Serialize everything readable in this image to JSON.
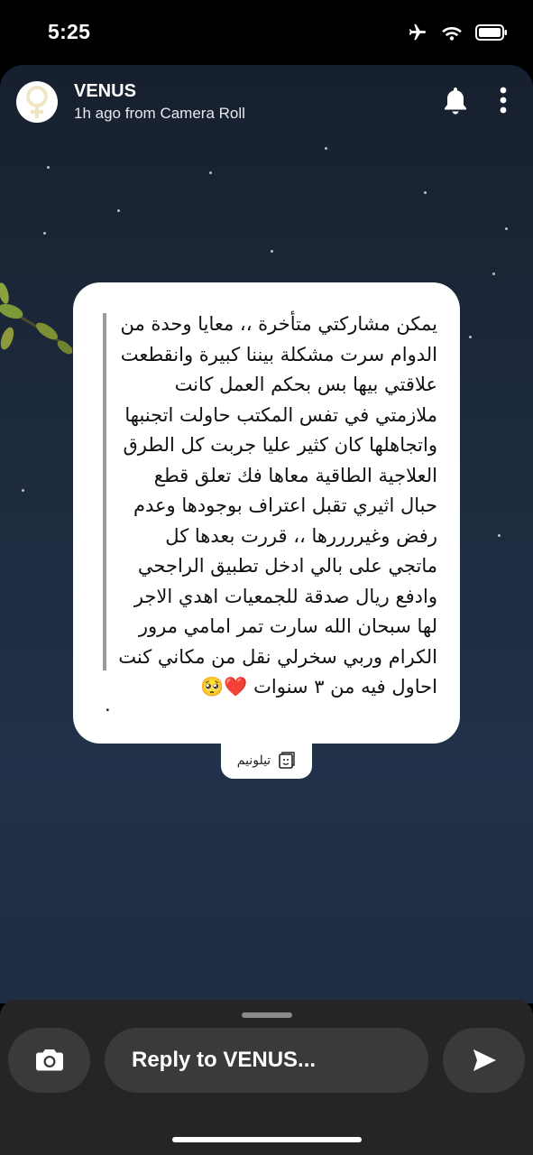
{
  "status_bar": {
    "time": "5:25",
    "icons": [
      "airplane-icon",
      "wifi-icon",
      "battery-icon"
    ]
  },
  "story": {
    "username": "VENUS",
    "meta": "1h ago from Camera Roll",
    "icons": [
      "bell-icon",
      "more-icon"
    ],
    "card": {
      "text": "يمكن مشاركتي متأخرة ،، معايا وحدة من الدوام سرت مشكلة بيننا كبيرة وانقطعت علاقتي بيها بس بحكم العمل كانت ملازمتي في تفس المكتب حاولت اتجنبها واتجاهلها كان كثير عليا جربت كل الطرق العلاجية الطاقية معاها فك تعلق قطع حبال اثيري تقبل اعتراف بوجودها وعدم رفض وغيررررها ،، قررت بعدها كل ماتجي على بالي ادخل تطبيق الراجحي وادفع ريال صدقة للجمعيات اهدي الاجر لها سبحان الله سارت تمر امامي مرور الكرام وربي سخرلي نقل من مكاني كنت احاول فيه من ٣ سنوات ❤️🥺",
      "footer_dot": "."
    },
    "source_label": "تيلونيم"
  },
  "reply_bar": {
    "placeholder": "Reply to VENUS...",
    "icons": [
      "camera-icon",
      "send-icon"
    ]
  },
  "colors": {
    "background": "#000000",
    "story_bg": "#1d2a3d",
    "card_bg": "#ffffff",
    "bar_bg": "#252525",
    "button_bg": "#3a3a3a"
  }
}
